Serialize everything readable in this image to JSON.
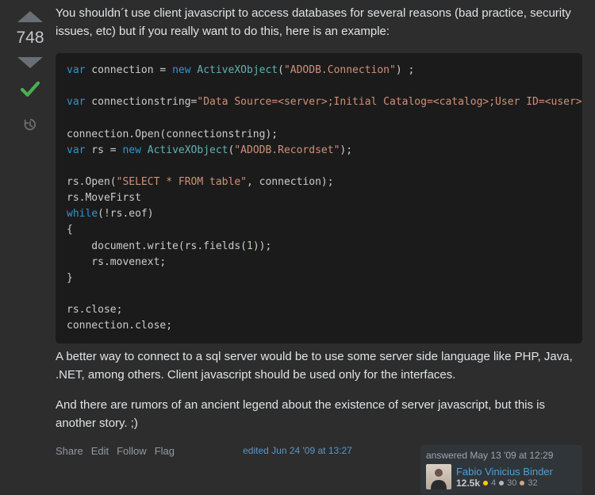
{
  "vote": {
    "score": "748"
  },
  "body": {
    "para1": "You shouldn´t use client javascript to access databases for several reasons (bad practice, security issues, etc) but if you really want to do this, here is an example:",
    "para2": "A better way to connect to a sql server would be to use some server side language like PHP, Java, .NET, among others. Client javascript should be used only for the interfaces.",
    "para3": "And there are rumors of an ancient legend about the existence of server javascript, but this is another story. ;)"
  },
  "code": {
    "t1a": "var",
    "t1b": " connection = ",
    "t1c": "new",
    "t1d": " ",
    "t1e": "ActiveXObject",
    "t1f": "(",
    "t1g": "\"ADODB.Connection\"",
    "t1h": ") ;",
    "t2a": "var",
    "t2b": " connectionstring=",
    "t2c": "\"Data Source=<server>;Initial Catalog=<catalog>;User ID=<user>;Password=<password>;Provider=SQLOLEDB\"",
    "t2d": ";",
    "t3": "connection.Open(connectionstring);",
    "t4a": "var",
    "t4b": " rs = ",
    "t4c": "new",
    "t4d": " ",
    "t4e": "ActiveXObject",
    "t4f": "(",
    "t4g": "\"ADODB.Recordset\"",
    "t4h": ");",
    "t5a": "rs.Open(",
    "t5b": "\"SELECT * FROM table\"",
    "t5c": ", connection);",
    "t6": "rs.MoveFirst",
    "t7a": "while",
    "t7b": "(!rs.eof)",
    "t8": "{",
    "t9a": "    document.write(rs.fields(",
    "t9b": "1",
    "t9c": "));",
    "t10": "    rs.movenext;",
    "t11": "}",
    "t12": "rs.close;",
    "t13": "connection.close;"
  },
  "actions": {
    "share": "Share",
    "edit": "Edit",
    "follow": "Follow",
    "flag": "Flag"
  },
  "edited": {
    "text": "edited Jun 24 '09 at 13:27"
  },
  "usercard": {
    "ts": "answered May 13 '09 at 12:29",
    "name": "Fabio Vinicius Binder",
    "rep": "12.5k",
    "gold": "4",
    "silver": "30",
    "bronze": "32"
  }
}
